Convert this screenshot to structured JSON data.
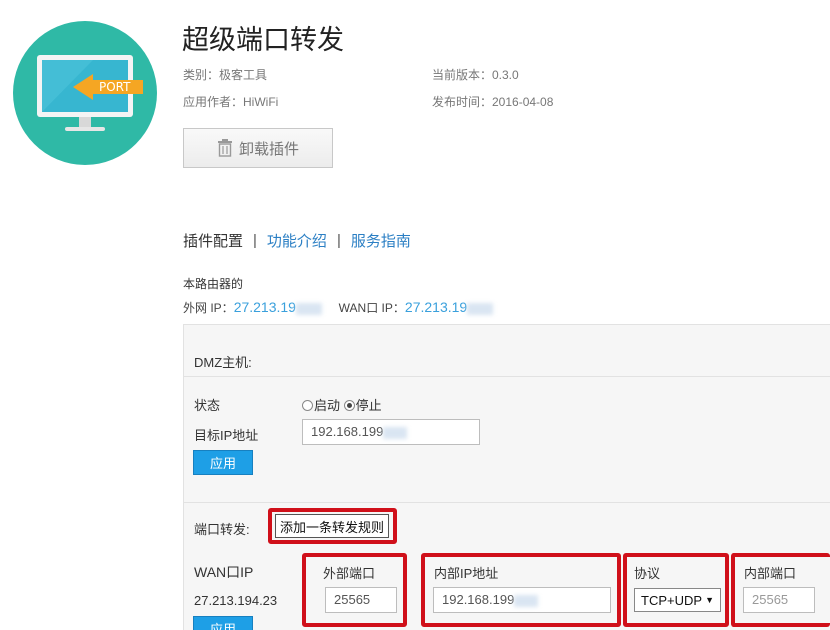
{
  "app": {
    "title": "超级端口转发",
    "category": "类别：极客工具",
    "version": "当前版本：0.3.0",
    "author": "应用作者：HiWiFi",
    "release_date": "发布时间：2016-04-08",
    "uninstall_label": "卸载插件",
    "logo_text": "PORT"
  },
  "tabs": [
    {
      "label": "插件配置",
      "active": true
    },
    {
      "label": "功能介绍",
      "active": false
    },
    {
      "label": "服务指南",
      "active": false
    }
  ],
  "tab_separator": "|",
  "router": {
    "heading": "本路由器的",
    "wan_public_label": "外网 IP：",
    "wan_public_value": "27.213.19",
    "wan_port_label": "WAN口 IP：",
    "wan_port_value": "27.213.19"
  },
  "dmz": {
    "heading": "DMZ主机:",
    "status_label": "状态",
    "option_start": "启动",
    "option_stop": "停止",
    "selected": "停止",
    "target_ip_label": "目标IP地址",
    "target_ip_value": "192.168.199",
    "apply_label": "应用"
  },
  "port_forward": {
    "heading": "端口转发:",
    "add_rule_label": "添加一条转发规则",
    "wan_ip_header": "WAN口IP",
    "wan_ip_value": "27.213.194.23",
    "external_port_header": "外部端口",
    "external_port_value": "25565",
    "internal_ip_header": "内部IP地址",
    "internal_ip_value": "192.168.199",
    "protocol_header": "协议",
    "protocol_value": "TCP+UDP",
    "internal_port_header": "内部端口",
    "internal_port_value": "25565",
    "apply_label": "应用"
  },
  "colors": {
    "link": "#2b7fc4",
    "ip_value": "#3aa0dc",
    "apply_button": "#1e9fe6",
    "highlight_box": "#d0101a",
    "logo_bg": "#2fb9a6"
  }
}
